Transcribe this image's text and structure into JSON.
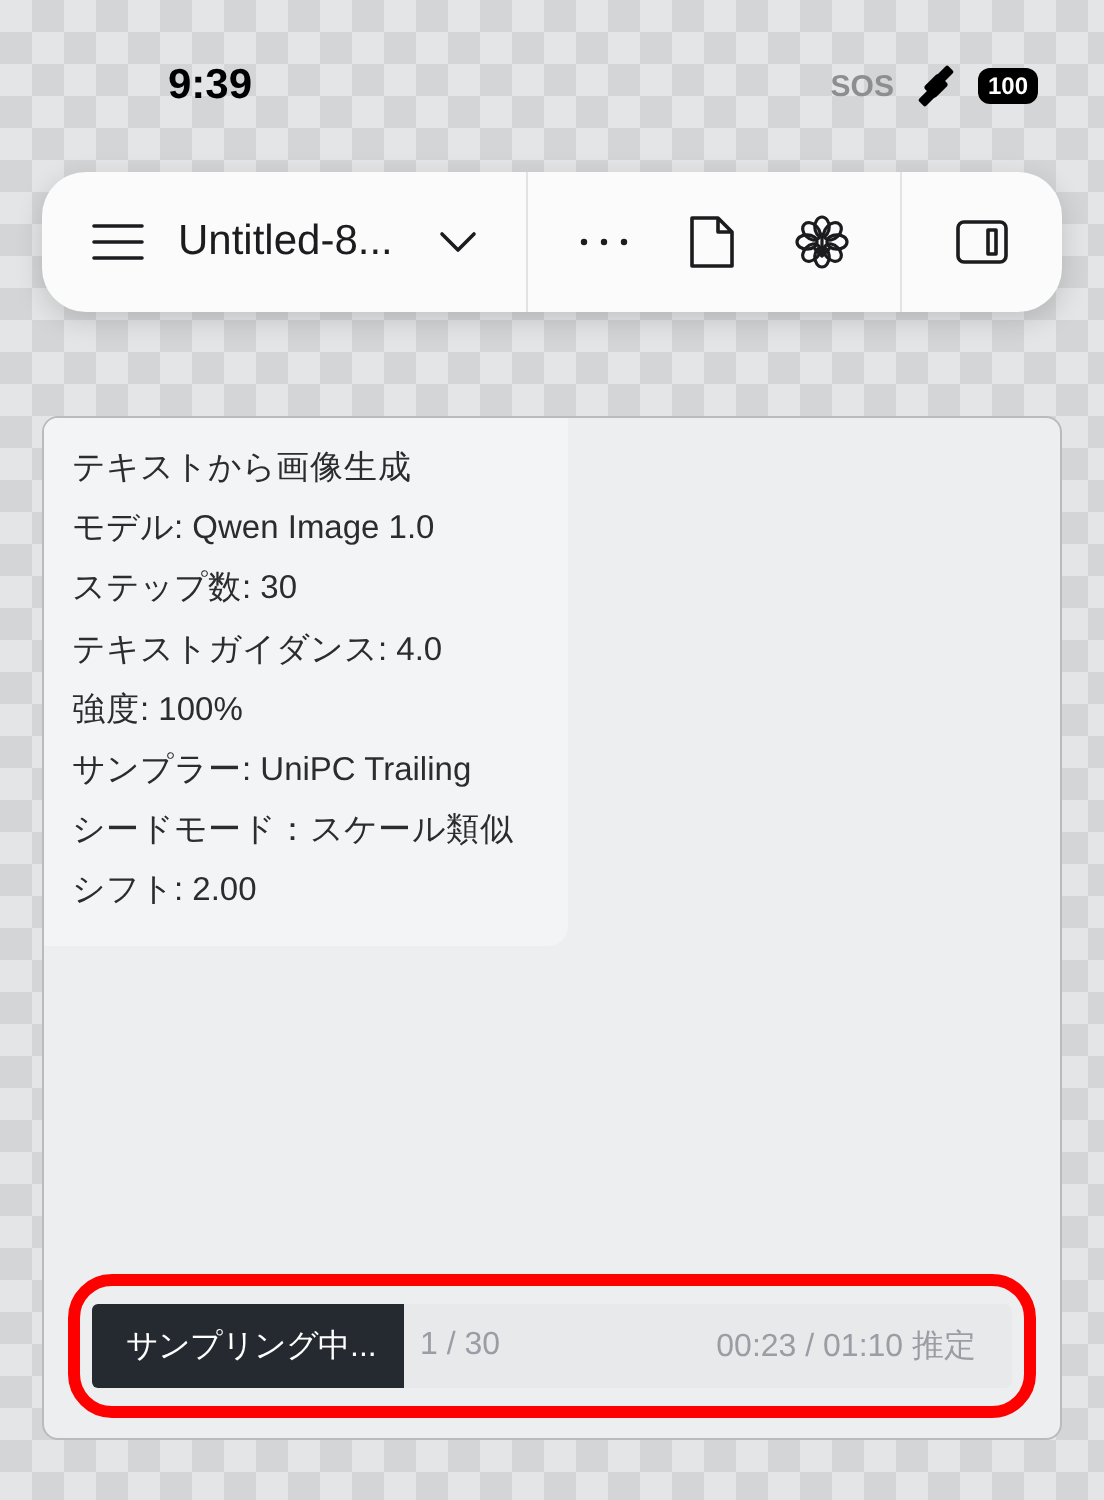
{
  "status_bar": {
    "time": "9:39",
    "sos": "SOS",
    "battery": "100"
  },
  "toolbar": {
    "title": "Untitled-8..."
  },
  "info_lines": [
    "テキストから画像生成",
    "モデル: Qwen Image 1.0",
    "ステップ数: 30",
    "テキストガイダンス: 4.0",
    "強度: 100%",
    "サンプラー: UniPC Trailing",
    "シードモード：スケール類似",
    "シフト: 2.00"
  ],
  "progress": {
    "label": "サンプリング中...",
    "count": "1 / 30",
    "time": "00:23 / 01:10 推定",
    "level": 0.34,
    "highlighted": true
  }
}
